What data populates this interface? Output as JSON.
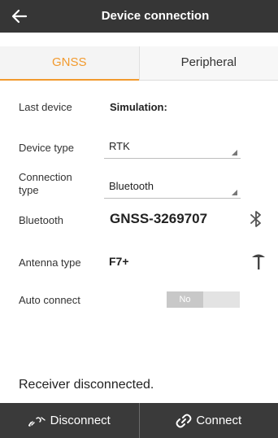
{
  "header": {
    "title": "Device connection",
    "back_icon": "back-arrow-icon"
  },
  "tabs": [
    {
      "label": "GNSS",
      "active": true
    },
    {
      "label": "Peripheral",
      "active": false
    }
  ],
  "form": {
    "last_device": {
      "label": "Last device",
      "value": "Simulation:"
    },
    "device_type": {
      "label": "Device type",
      "value": "RTK"
    },
    "connection_type": {
      "label_line1": "Connection",
      "label_line2": "type",
      "value": "Bluetooth"
    },
    "bluetooth": {
      "label": "Bluetooth",
      "value": "GNSS-3269707",
      "icon": "bluetooth-icon"
    },
    "antenna_type": {
      "label": "Antenna type",
      "value": "F7+",
      "icon": "antenna-icon"
    },
    "auto_connect": {
      "label": "Auto connect",
      "value": "No"
    }
  },
  "status": {
    "text": "Receiver disconnected."
  },
  "bottom_bar": {
    "disconnect_label": "Disconnect",
    "connect_label": "Connect"
  },
  "colors": {
    "accent": "#f29a2e",
    "header_bg": "#363636",
    "bottom_bar_bg": "#3a3a3a"
  }
}
